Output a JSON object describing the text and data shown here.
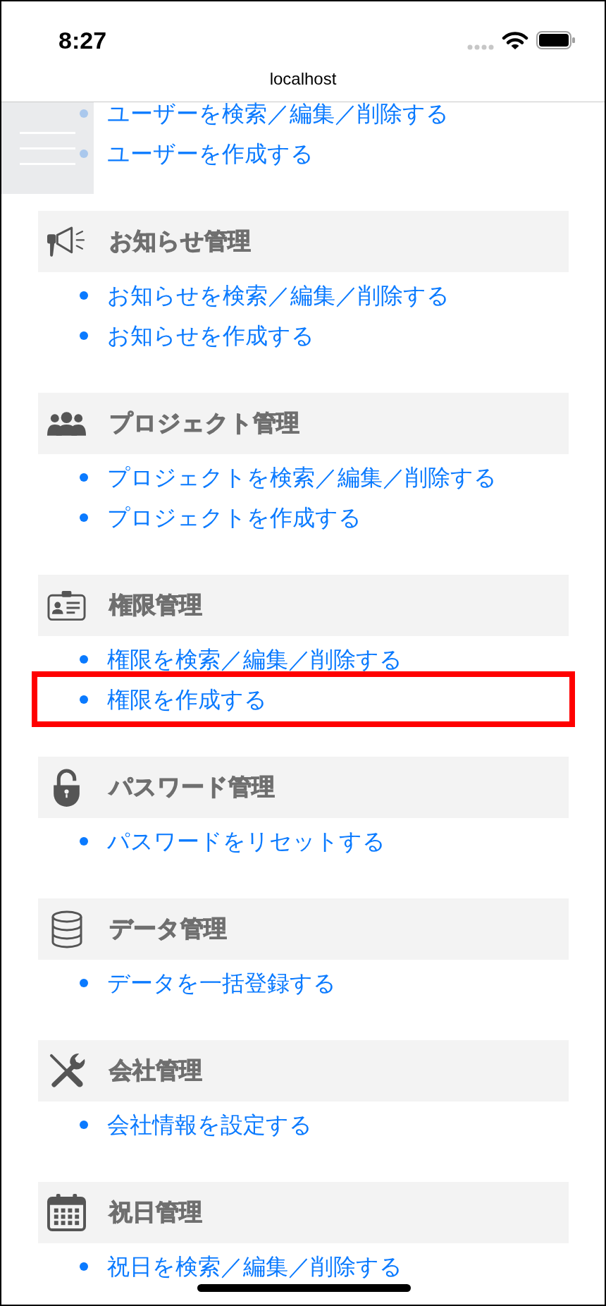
{
  "status_bar": {
    "time": "8:27"
  },
  "address_bar": {
    "url": "localhost"
  },
  "sections": [
    {
      "items": [
        {
          "label": "ユーザーを検索／編集／削除する",
          "highlighted": false
        },
        {
          "label": "ユーザーを作成する",
          "highlighted": false
        }
      ]
    },
    {
      "title": "お知らせ管理",
      "items": [
        {
          "label": "お知らせを検索／編集／削除する",
          "highlighted": false
        },
        {
          "label": "お知らせを作成する",
          "highlighted": false
        }
      ]
    },
    {
      "title": "プロジェクト管理",
      "items": [
        {
          "label": "プロジェクトを検索／編集／削除する",
          "highlighted": false
        },
        {
          "label": "プロジェクトを作成する",
          "highlighted": false
        }
      ]
    },
    {
      "title": "権限管理",
      "items": [
        {
          "label": "権限を検索／編集／削除する",
          "highlighted": false
        },
        {
          "label": "権限を作成する",
          "highlighted": true
        }
      ]
    },
    {
      "title": "パスワード管理",
      "items": [
        {
          "label": "パスワードをリセットする",
          "highlighted": false
        }
      ]
    },
    {
      "title": "データ管理",
      "items": [
        {
          "label": "データを一括登録する",
          "highlighted": false
        }
      ]
    },
    {
      "title": "会社管理",
      "items": [
        {
          "label": "会社情報を設定する",
          "highlighted": false
        }
      ]
    },
    {
      "title": "祝日管理",
      "items": [
        {
          "label": "祝日を検索／編集／削除する",
          "highlighted": false
        }
      ]
    }
  ]
}
